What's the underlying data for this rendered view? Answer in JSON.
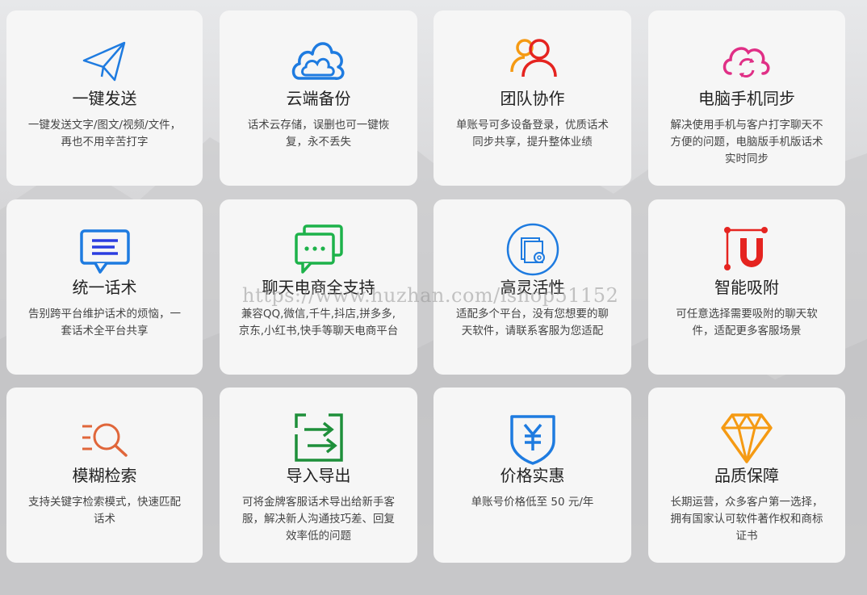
{
  "cards": [
    {
      "title": "一键发送",
      "desc": "一键发送文字/图文/视频/文件，再也不用辛苦打字",
      "icon": "paper-plane-icon"
    },
    {
      "title": "云端备份",
      "desc": "话术云存储，误删也可一键恢复，永不丢失",
      "icon": "cloud-icon"
    },
    {
      "title": "团队协作",
      "desc": "单账号可多设备登录，优质话术同步共享，提升整体业绩",
      "icon": "team-users-icon"
    },
    {
      "title": "电脑手机同步",
      "desc": "解决使用手机与客户打字聊天不方便的问题，电脑版手机版话术实时同步",
      "icon": "cloud-sync-icon"
    },
    {
      "title": "统一话术",
      "desc": "告别跨平台维护话术的烦恼，一套话术全平台共享",
      "icon": "message-icon"
    },
    {
      "title": "聊天电商全支持",
      "desc": "兼容QQ,微信,千牛,抖店,拼多多,京东,小红书,快手等聊天电商平台",
      "icon": "chat-bubbles-icon"
    },
    {
      "title": "高灵活性",
      "desc": "适配多个平台，没有您想要的聊天软件，请联系客服为您适配",
      "icon": "settings-doc-icon"
    },
    {
      "title": "智能吸附",
      "desc": "可任意选择需要吸附的聊天软件，适配更多客服场景",
      "icon": "magnet-icon"
    },
    {
      "title": "模糊检索",
      "desc": "支持关键字检索模式，快速匹配话术",
      "icon": "search-list-icon"
    },
    {
      "title": "导入导出",
      "desc": "可将金牌客服话术导出给新手客服，解决新人沟通技巧差、回复效率低的问题",
      "icon": "import-export-icon"
    },
    {
      "title": "价格实惠",
      "desc": "单账号价格低至 50 元/年",
      "icon": "yuan-shield-icon"
    },
    {
      "title": "品质保障",
      "desc": "长期运营，众多客户第一选择，拥有国家认可软件著作权和商标证书",
      "icon": "diamond-icon"
    }
  ],
  "watermark": "https://www.huzhan.com/ishop51152",
  "colors": {
    "blue": "#1e7be0",
    "red": "#e52420",
    "orange": "#f59a13",
    "pink": "#e02f86",
    "green": "#1db24a",
    "darkgreen": "#1e8f3a",
    "diamond": "#f59a13",
    "search": "#e0663a"
  }
}
